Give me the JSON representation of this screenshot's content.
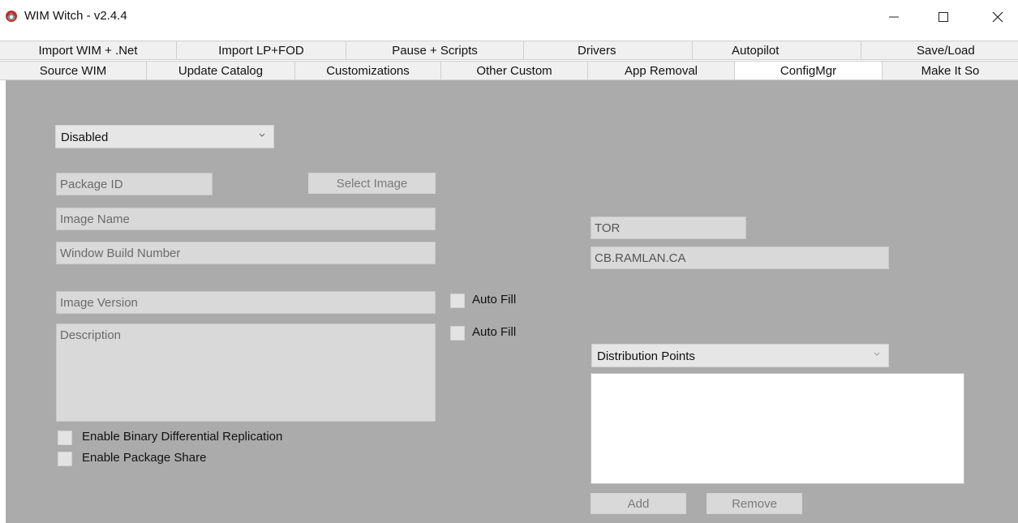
{
  "window": {
    "title": "WIM Witch - v2.4.4",
    "controls": {
      "minimize": "—",
      "maximize": "☐",
      "close": "✕"
    }
  },
  "tabs_row1": [
    "Import WIM + .Net",
    "Import LP+FOD",
    "Pause + Scripts",
    "Drivers",
    "Autopilot",
    "Save/Load"
  ],
  "tabs_row2": [
    "Source WIM",
    "Update Catalog",
    "Customizations",
    "Other Custom",
    "App Removal",
    "ConfigMgr",
    "Make It So"
  ],
  "selected_tab": "ConfigMgr",
  "configmgr": {
    "mode_select": "Disabled",
    "package_id_placeholder": "Package ID",
    "select_image_button": "Select Image",
    "image_name_placeholder": "Image Name",
    "build_number_placeholder": "Window Build Number",
    "image_version_placeholder": "Image Version",
    "description_placeholder": "Description",
    "auto_fill_label": "Auto Fill",
    "binary_diff_label": "Enable Binary Differential Replication",
    "package_share_label": "Enable Package Share",
    "site_code": "TOR",
    "site_server": "CB.RAMLAN.CA",
    "dp_select": "Distribution Points",
    "add_button": "Add",
    "remove_button": "Remove"
  },
  "colors": {
    "panel": "#ababab",
    "field": "#d9d9d9",
    "tab_strip": "#f0f0f0",
    "selected_tab": "#ffffff"
  }
}
